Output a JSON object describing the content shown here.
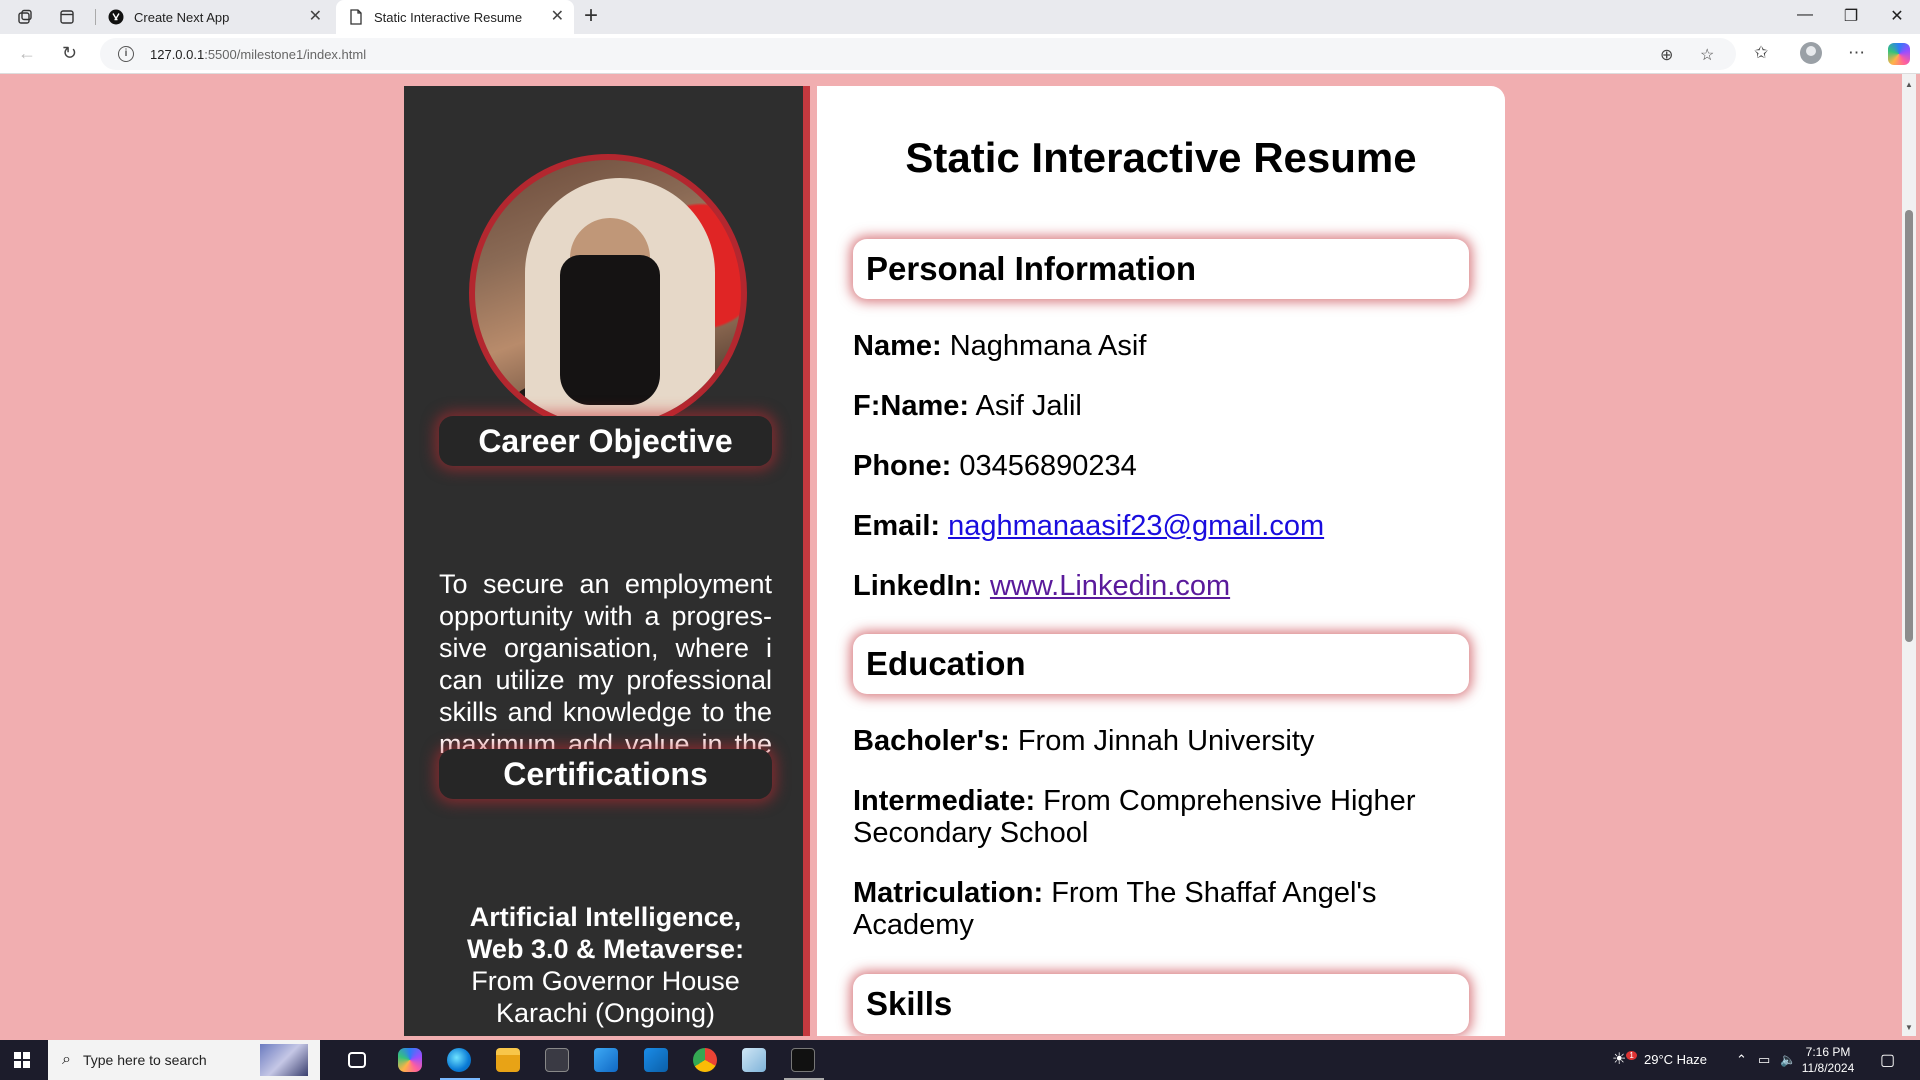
{
  "browser": {
    "tabs": [
      {
        "title": "Create Next App",
        "active": false
      },
      {
        "title": "Static Interactive Resume",
        "active": true
      }
    ],
    "url_host": "127.0.0.1",
    "url_path": ":5500/milestone1/index.html"
  },
  "resume": {
    "title": "Static Interactive Resume",
    "sidebar": {
      "career_heading": "Career Objective",
      "career_text": "To secure an employment opportunity with a progres­sive organisation, where i can utilize my professional skills and knowledge to the maximum add value in the growth of organization.",
      "cert_heading": "Certifications",
      "cert_bold": "Artificial Intelligence, Web 3.0 & Metaverse:",
      "cert_text": "From Governor House Karachi (Ongoing)"
    },
    "personal": {
      "heading": "Personal Information",
      "name_label": "Name:",
      "name": "Naghmana Asif",
      "fname_label": "F:Name:",
      "fname": "Asif Jalil",
      "phone_label": "Phone:",
      "phone": "03456890234",
      "email_label": "Email:",
      "email": "naghmanaasif23@gmail.com",
      "linkedin_label": "LinkedIn:",
      "linkedin": "www.Linkedin.com"
    },
    "education": {
      "heading": "Education",
      "bach_label": "Bacholer's:",
      "bach": "From Jinnah University",
      "inter_label": "Intermediate:",
      "inter": "From Comprehensive Higher Secondary School",
      "matric_label": "Matriculation:",
      "matric": "From The Shaffaf Angel's Academy"
    },
    "skills": {
      "heading": "Skills"
    }
  },
  "taskbar": {
    "search_placeholder": "Type here to search",
    "weather": "29°C  Haze",
    "weather_badge": "1",
    "time": "7:16 PM",
    "date": "11/8/2024"
  },
  "colors": {
    "page_bg": "#f1aeb0",
    "sidebar_bg": "#2e2e2e",
    "accent": "#c4393f",
    "link": "#1a0dde",
    "link_visited": "#5a1a9b"
  }
}
